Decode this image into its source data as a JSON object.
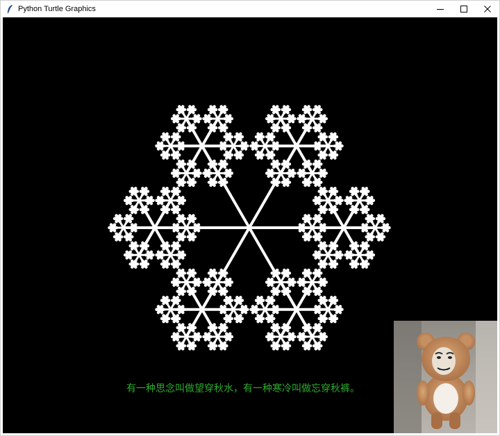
{
  "window": {
    "title": "Python Turtle Graphics",
    "controls": [
      "minimize",
      "maximize",
      "close"
    ]
  },
  "canvas": {
    "background": "#000000",
    "drawing": "fractal-snowflake",
    "stroke_color": "#ffffff",
    "caption": "有一种思念叫做望穿秋水，有一种寒冷叫做忘穿秋裤。",
    "caption_color": "#2faa2f"
  },
  "sticker": {
    "icon": "teddy-bear-meme-icon"
  }
}
